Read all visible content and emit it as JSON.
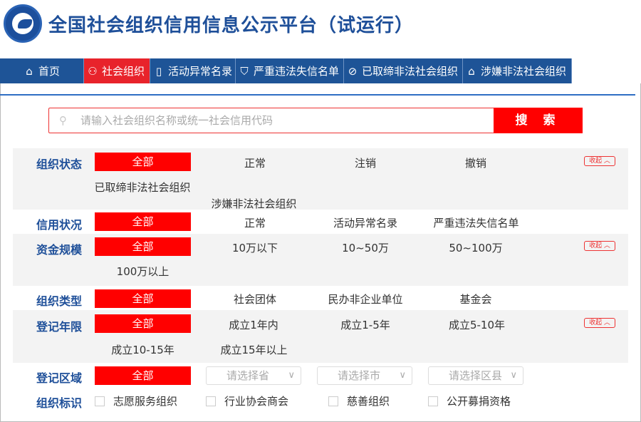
{
  "header": {
    "title": "全国社会组织信用信息公示平台（试运行）"
  },
  "nav": {
    "items": [
      {
        "label": "首页",
        "icon": "home-icon"
      },
      {
        "label": "社会组织",
        "icon": "org-icon",
        "active": true
      },
      {
        "label": "活动异常名录",
        "icon": "list-icon"
      },
      {
        "label": "严重违法失信名单",
        "icon": "shield-icon"
      },
      {
        "label": "已取缔非法社会组织",
        "icon": "ban-icon"
      },
      {
        "label": "涉嫌非法社会组织",
        "icon": "warning-icon"
      }
    ]
  },
  "search": {
    "placeholder": "请输入社会组织名称或统一社会信用代码",
    "button": "搜 索"
  },
  "filters": {
    "status": {
      "label": "组织状态",
      "all": "全部",
      "options": [
        "正常",
        "注销",
        "撤销",
        "已取缔非法社会组织",
        "涉嫌非法社会组织"
      ],
      "collapse": "收起 ︿"
    },
    "credit": {
      "label": "信用状况",
      "all": "全部",
      "options": [
        "正常",
        "活动异常名录",
        "严重违法失信名单"
      ]
    },
    "capital": {
      "label": "资金规模",
      "all": "全部",
      "options": [
        "10万以下",
        "10~50万",
        "50~100万",
        "100万以上"
      ],
      "collapse": "收起 ︿"
    },
    "type": {
      "label": "组织类型",
      "all": "全部",
      "options": [
        "社会团体",
        "民办非企业单位",
        "基金会"
      ]
    },
    "years": {
      "label": "登记年限",
      "all": "全部",
      "options": [
        "成立1年内",
        "成立1-5年",
        "成立5-10年",
        "成立10-15年",
        "成立15年以上"
      ],
      "collapse": "收起 ︿"
    },
    "region": {
      "label": "登记区域",
      "all": "全部",
      "selects": [
        "请选择省",
        "请选择市",
        "请选择区县"
      ]
    },
    "tag": {
      "label": "组织标识",
      "checks": [
        "志愿服务组织",
        "行业协会商会",
        "慈善组织",
        "公开募捐资格"
      ]
    }
  },
  "colors": {
    "brand_blue": "#1e5497",
    "accent_red": "#ff0000"
  }
}
